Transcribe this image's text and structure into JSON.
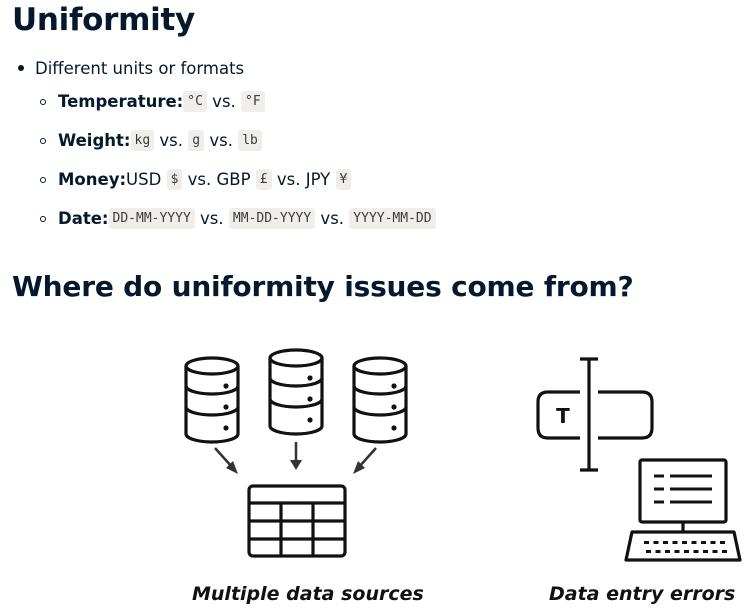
{
  "title": "Uniformity",
  "bullet": "Different units or formats",
  "items": [
    {
      "label": "Temperature:",
      "parts": [
        {
          "code": "°C"
        },
        {
          "text": " vs. "
        },
        {
          "code": "°F"
        }
      ]
    },
    {
      "label": "Weight:",
      "parts": [
        {
          "code": "kg"
        },
        {
          "text": " vs. "
        },
        {
          "code": "g"
        },
        {
          "text": " vs. "
        },
        {
          "code": "lb"
        }
      ]
    },
    {
      "label": "Money:",
      "parts": [
        {
          "text": "USD "
        },
        {
          "code": "$"
        },
        {
          "text": " vs. GBP "
        },
        {
          "code": "£"
        },
        {
          "text": " vs. JPY "
        },
        {
          "code": "¥"
        }
      ]
    },
    {
      "label": "Date:",
      "parts": [
        {
          "code": "DD-MM-YYYY"
        },
        {
          "text": " vs. "
        },
        {
          "code": "MM-DD-YYYY"
        },
        {
          "text": " vs. "
        },
        {
          "code": "YYYY-MM-DD"
        }
      ]
    }
  ],
  "heading2": "Where do uniformity issues come from?",
  "icons": {
    "sources": "database-icon",
    "table": "table-icon",
    "text_field": "text-field-icon",
    "computer": "computer-icon",
    "text_field_letter": "T"
  },
  "captions": {
    "left": "Multiple data sources",
    "right": "Data entry errors"
  }
}
